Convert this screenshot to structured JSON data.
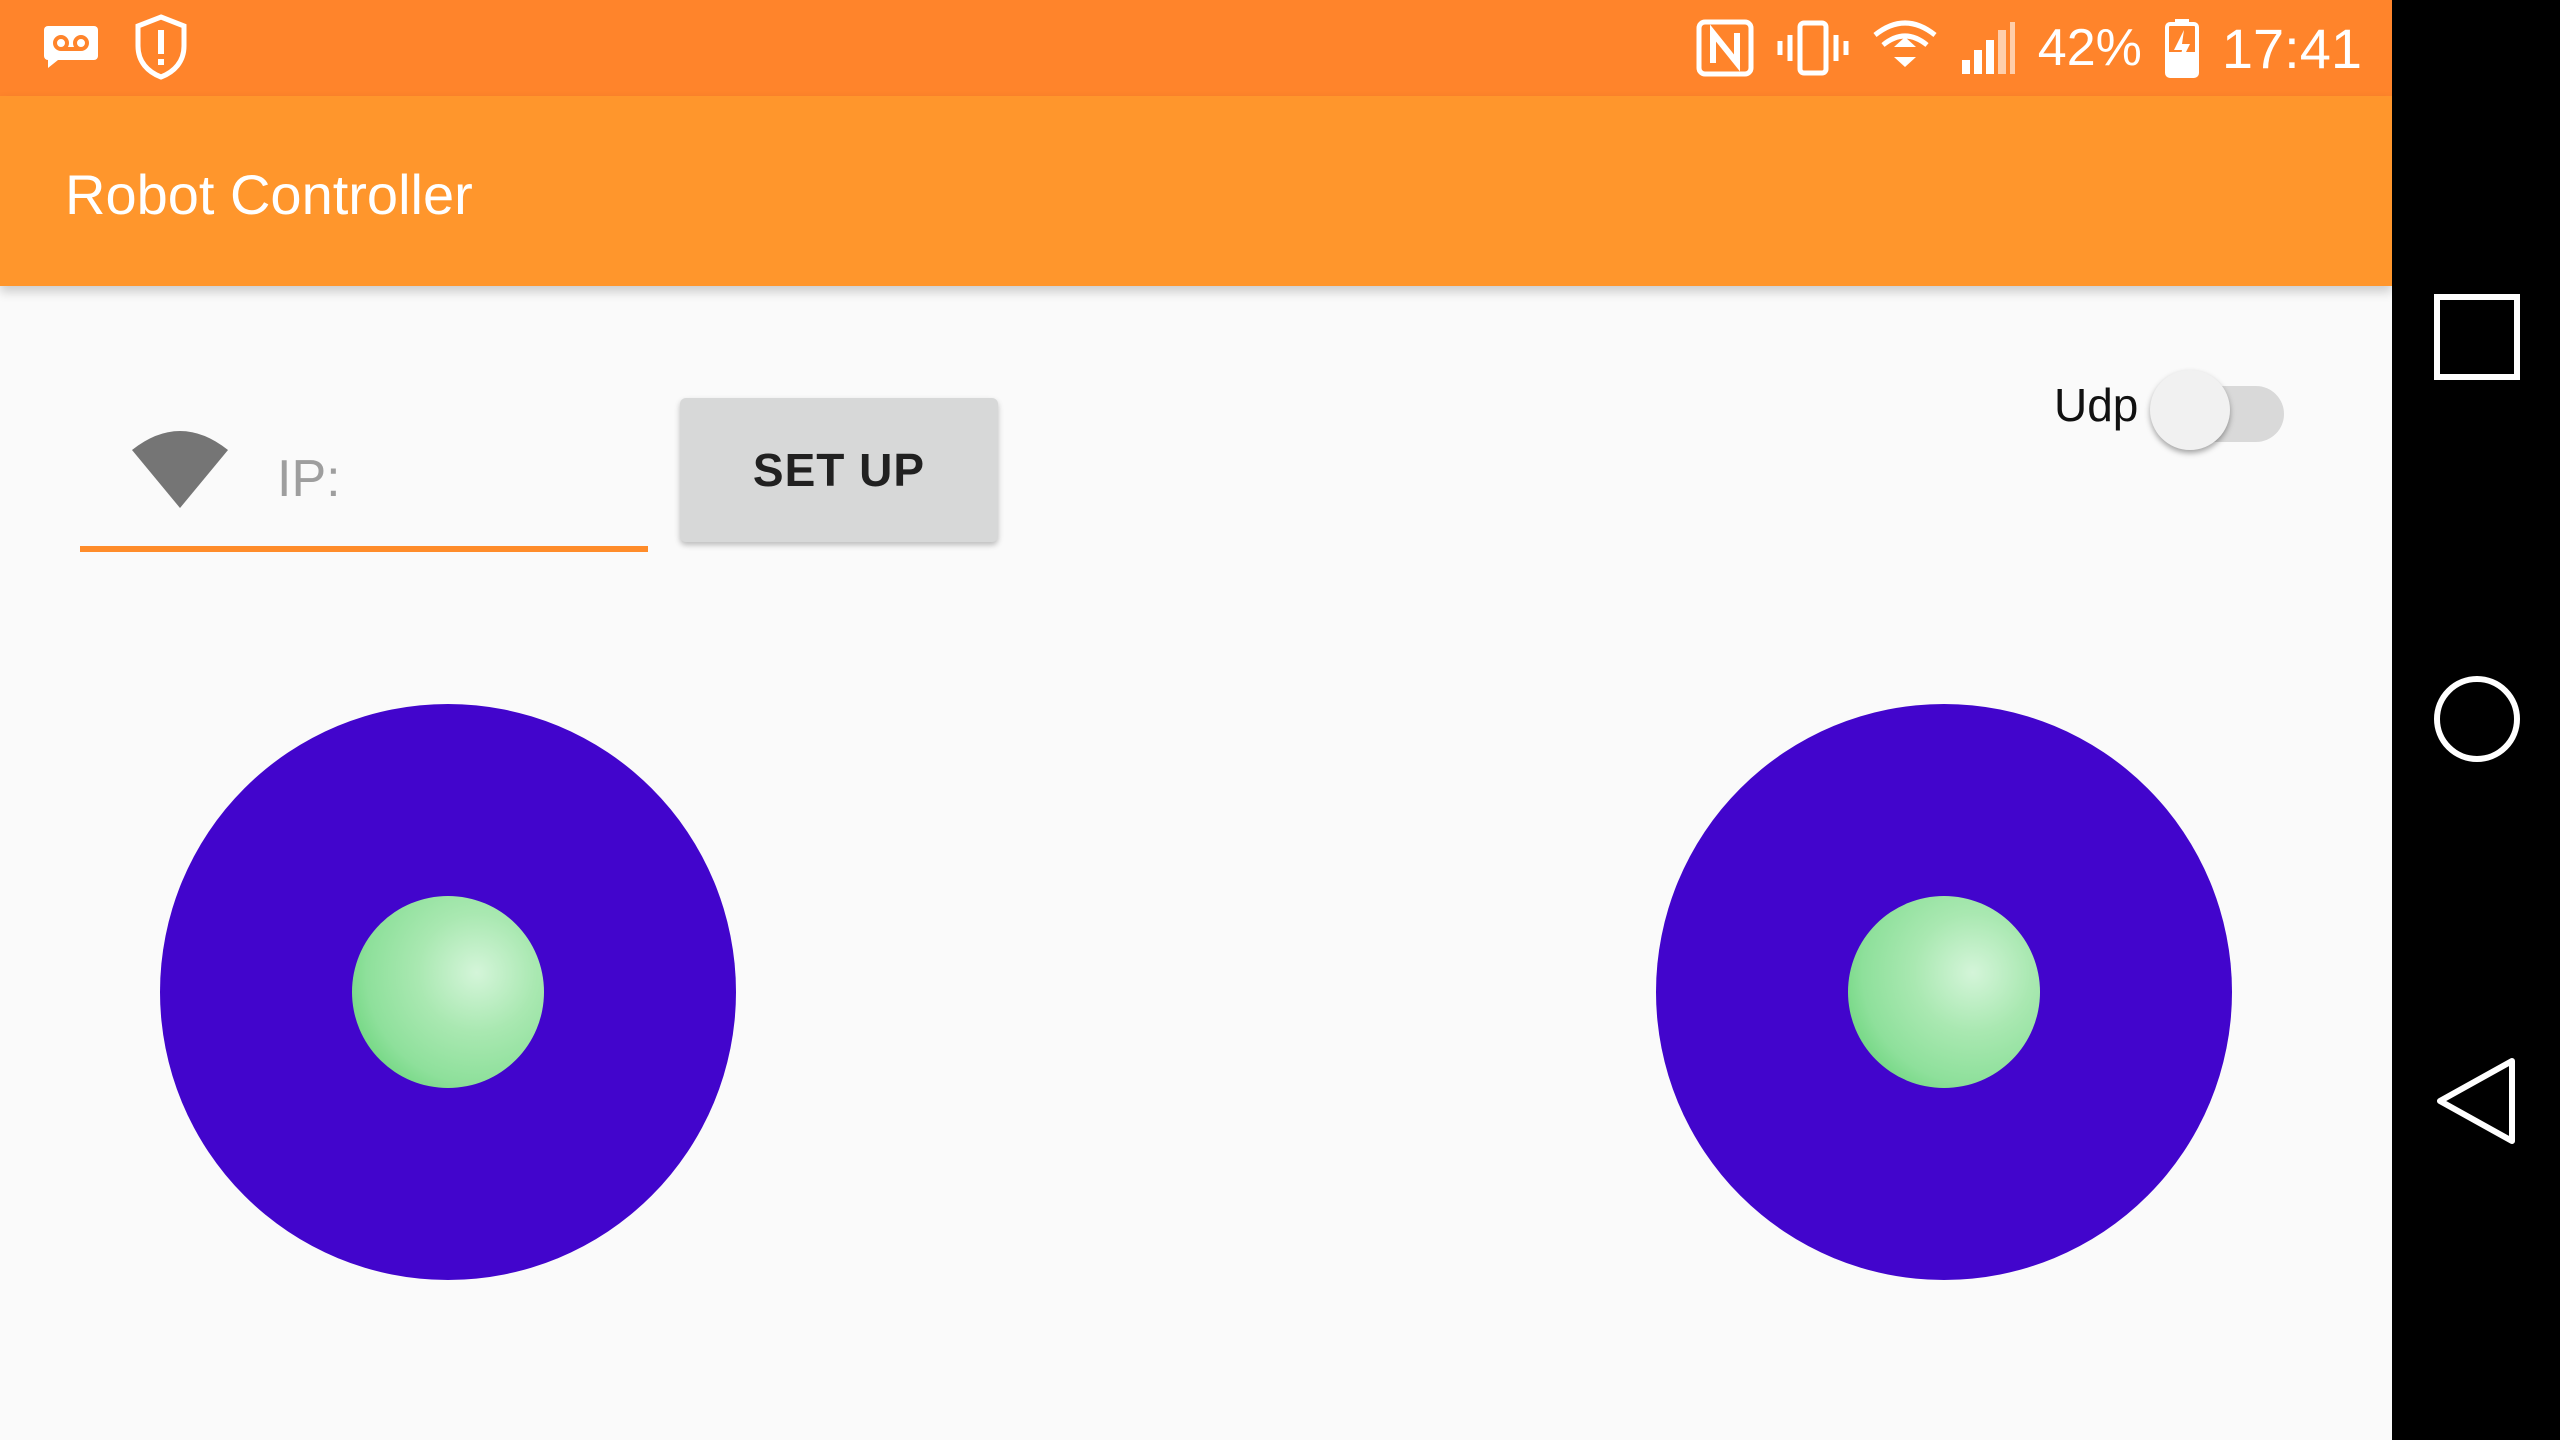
{
  "status_bar": {
    "battery": "42%",
    "time": "17:41",
    "icons": [
      "voicemail-icon",
      "shield-alert-icon",
      "nfc-icon",
      "vibrate-icon",
      "wifi-status-icon",
      "signal-icon",
      "battery-charging-icon"
    ]
  },
  "app_bar": {
    "title": "Robot Controller"
  },
  "connection": {
    "ip_placeholder": "IP:",
    "ip_value": "",
    "setup_label": "SET UP"
  },
  "udp": {
    "label": "Udp",
    "enabled": false
  },
  "colors": {
    "status_bar": "#ff842b",
    "app_bar": "#ff962c",
    "accent": "#ff8c2a",
    "joystick_base": "#4205cc",
    "joystick_knob": "#8ee09b"
  },
  "nav_bar": {
    "icons": [
      "recents-icon",
      "home-icon",
      "back-icon"
    ]
  }
}
